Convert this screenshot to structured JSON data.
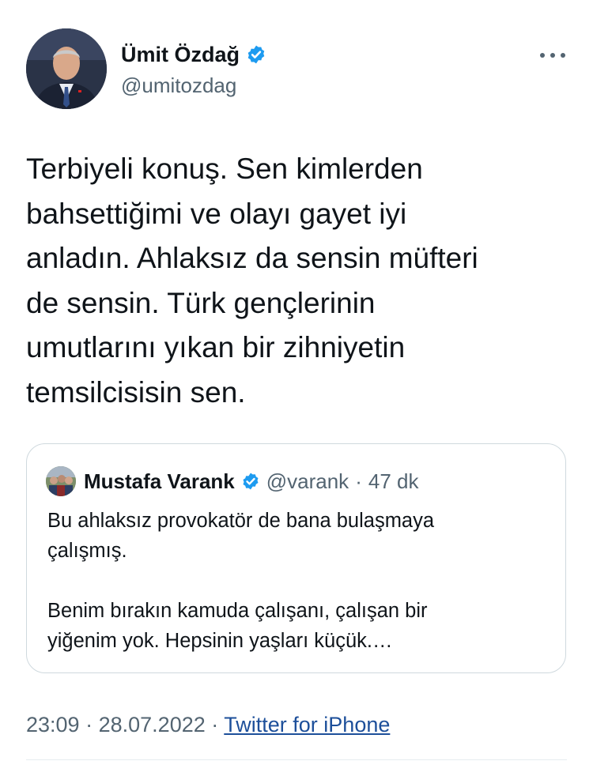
{
  "author": {
    "name": "Ümit Özdağ",
    "handle": "@umitozdag",
    "avatar_icon": "profile-photo",
    "verified_icon": "verified-badge-icon"
  },
  "more_icon": "more-options-icon",
  "tweet": {
    "lines": [
      "Terbiyeli konuş. Sen kimlerden",
      "bahsettiğimi ve olayı gayet iyi",
      "anladın. Ahlaksız da sensin müfteri",
      "de sensin. Türk gençlerinin",
      "umutlarını yıkan bir zihniyetin",
      "temsilcisisin sen."
    ]
  },
  "quote": {
    "name": "Mustafa Varank",
    "handle": "@varank",
    "separator": "·",
    "time": "47 dk",
    "paragraph1": [
      "Bu ahlaksız provokatör de bana bulaşmaya",
      "çalışmış."
    ],
    "paragraph2": [
      "Benim bırakın kamuda çalışanı, çalışan bir",
      "yiğenim yok. Hepsinin yaşları küçük.…"
    ]
  },
  "meta": {
    "time": "23:09",
    "separator": "·",
    "date": "28.07.2022",
    "source": "Twitter for iPhone"
  },
  "colors": {
    "text": "#0f1419",
    "secondary": "#536471",
    "verified": "#1d9bf0",
    "link": "#1d4f9a",
    "border": "#cfd9de"
  }
}
